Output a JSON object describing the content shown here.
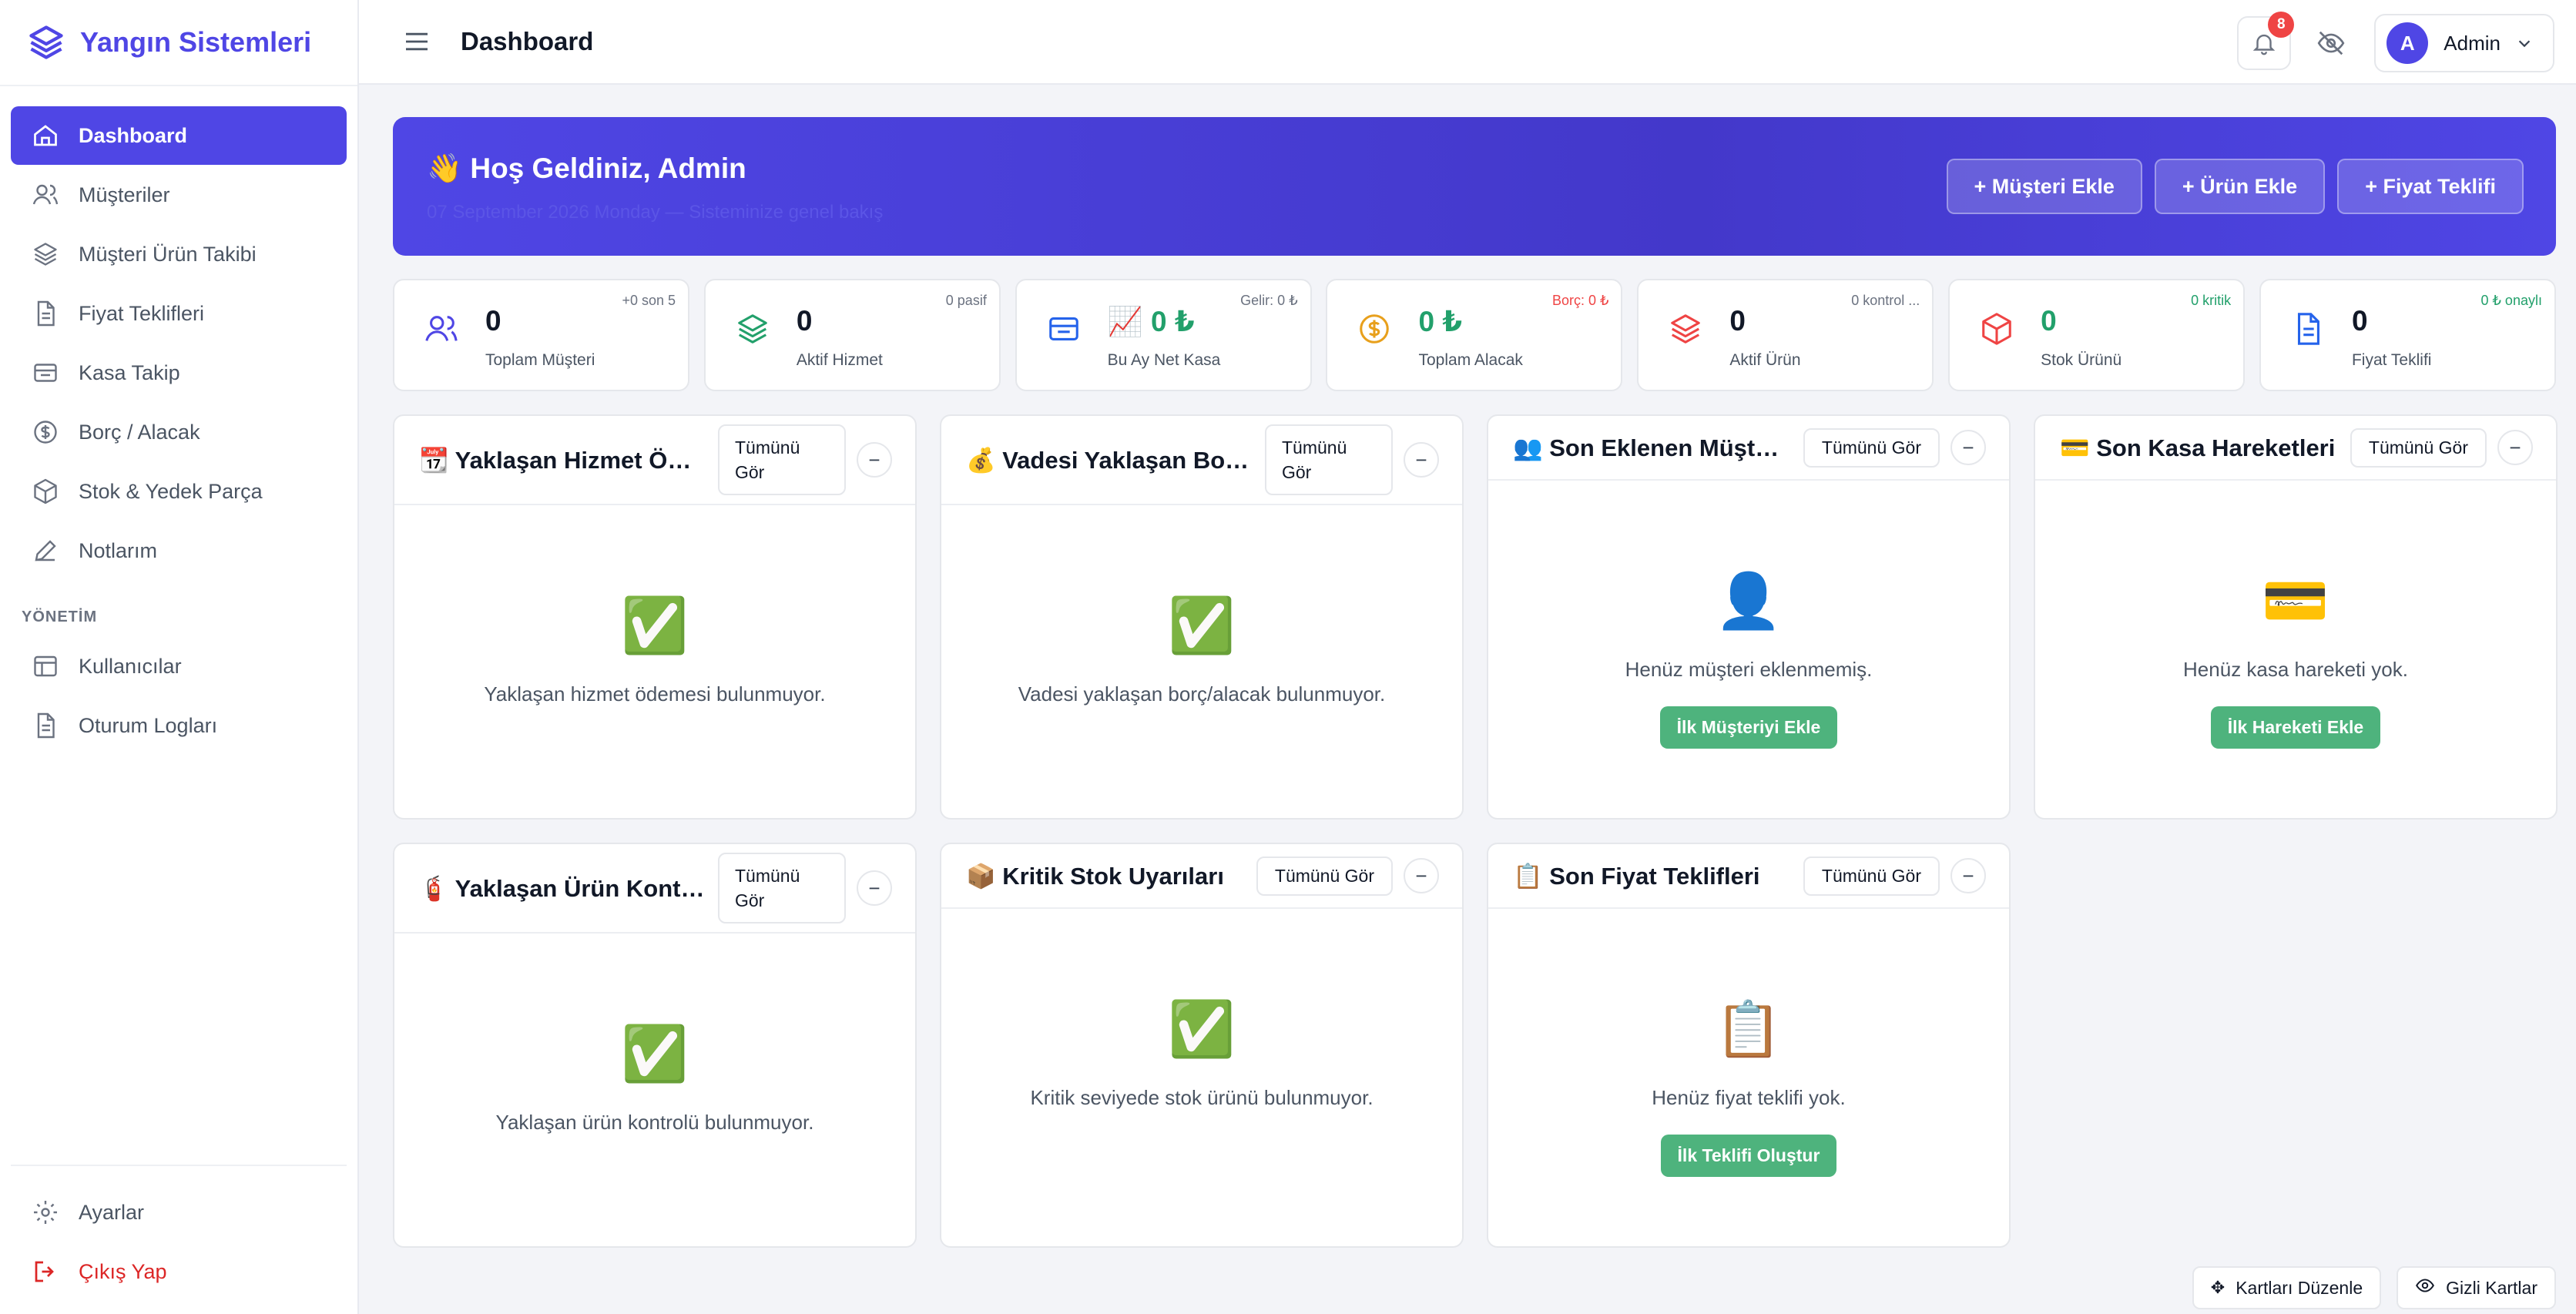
{
  "brand": {
    "name": "Yangın Sistemleri"
  },
  "sidebar": {
    "items": [
      {
        "label": "Dashboard",
        "icon": "home-icon"
      },
      {
        "label": "Müşteriler",
        "icon": "users-icon"
      },
      {
        "label": "Müşteri Ürün Takibi",
        "icon": "layers-icon"
      },
      {
        "label": "Fiyat Teklifleri",
        "icon": "document-icon"
      },
      {
        "label": "Kasa Takip",
        "icon": "cashbox-icon"
      },
      {
        "label": "Borç / Alacak",
        "icon": "dollar-circle-icon"
      },
      {
        "label": "Stok & Yedek Parça",
        "icon": "box-icon"
      },
      {
        "label": "Notlarım",
        "icon": "pencil-icon"
      }
    ],
    "section_label": "YÖNETİM",
    "admin_items": [
      {
        "label": "Kullanıcılar",
        "icon": "table-icon"
      },
      {
        "label": "Oturum Logları",
        "icon": "document-icon"
      }
    ],
    "bottom_items": [
      {
        "label": "Ayarlar",
        "icon": "settings-icon"
      },
      {
        "label": "Çıkış Yap",
        "icon": "logout-icon"
      }
    ]
  },
  "header": {
    "title": "Dashboard",
    "notification_count": "8",
    "user_initial": "A",
    "user_name": "Admin"
  },
  "hero": {
    "title": "👋 Hoş Geldiniz, Admin",
    "subtitle": "07 September 2026 Monday — Sisteminize genel bakış",
    "actions": [
      "+ Müşteri Ekle",
      "+ Ürün Ekle",
      "+ Fiyat Teklifi"
    ]
  },
  "stats": [
    {
      "value": "0",
      "label": "Toplam Müşteri",
      "note": "+0 son 5",
      "icon": "users-icon"
    },
    {
      "value": "0",
      "label": "Aktif Hizmet",
      "note": "0 pasif",
      "icon": "layers-icon"
    },
    {
      "value": "📈 0 ₺",
      "label": "Bu Ay Net Kasa",
      "note": "Gelir: 0 ₺",
      "icon": "cashbox-icon"
    },
    {
      "value": "0 ₺",
      "label": "Toplam Alacak",
      "note": "Borç: 0 ₺",
      "icon": "dollar-circle-icon"
    },
    {
      "value": "0",
      "label": "Aktif Ürün",
      "note": "0 kontrol ...",
      "icon": "layers-icon"
    },
    {
      "value": "0",
      "label": "Stok Ürünü",
      "note": "0 kritik",
      "icon": "box-icon"
    },
    {
      "value": "0",
      "label": "Fiyat Teklifi",
      "note": "0 ₺ onaylı",
      "icon": "document-icon"
    }
  ],
  "cards": [
    {
      "title": "📆 Yaklaşan Hizmet Öde...",
      "see_all": "Tümünü Gör",
      "emoji": "✅",
      "message": "Yaklaşan hizmet ödemesi bulunmuyor.",
      "cta": ""
    },
    {
      "title": "💰 Vadesi Yaklaşan Borç / ...",
      "see_all": "Tümünü Gör",
      "emoji": "✅",
      "message": "Vadesi yaklaşan borç/alacak bulunmuyor.",
      "cta": ""
    },
    {
      "title": "👥 Son Eklenen Müşteriler",
      "see_all": "Tümünü Gör",
      "emoji": "👤",
      "message": "Henüz müşteri eklenmemiş.",
      "cta": "İlk Müşteriyi Ekle"
    },
    {
      "title": "💳 Son Kasa Hareketleri",
      "see_all": "Tümünü Gör",
      "emoji": "💳",
      "message": "Henüz kasa hareketi yok.",
      "cta": "İlk Hareketi Ekle"
    },
    {
      "title": "🧯 Yaklaşan Ürün Kontro...",
      "see_all": "Tümünü Gör",
      "emoji": "✅",
      "message": "Yaklaşan ürün kontrolü bulunmuyor.",
      "cta": ""
    },
    {
      "title": "📦 Kritik Stok Uyarıları",
      "see_all": "Tümünü Gör",
      "emoji": "✅",
      "message": "Kritik seviyede stok ürünü bulunmuyor.",
      "cta": ""
    },
    {
      "title": "📋 Son Fiyat Teklifleri",
      "see_all": "Tümünü Gör",
      "emoji": "📋",
      "message": "Henüz fiyat teklifi yok.",
      "cta": "İlk Teklifi Oluştur"
    }
  ],
  "footer": {
    "edit_cards": "Kartları Düzenle",
    "hidden_cards": "Gizli Kartlar"
  },
  "colors": {
    "accent": "#4f46e5",
    "success": "#4eb37d",
    "danger": "#ef4444"
  }
}
